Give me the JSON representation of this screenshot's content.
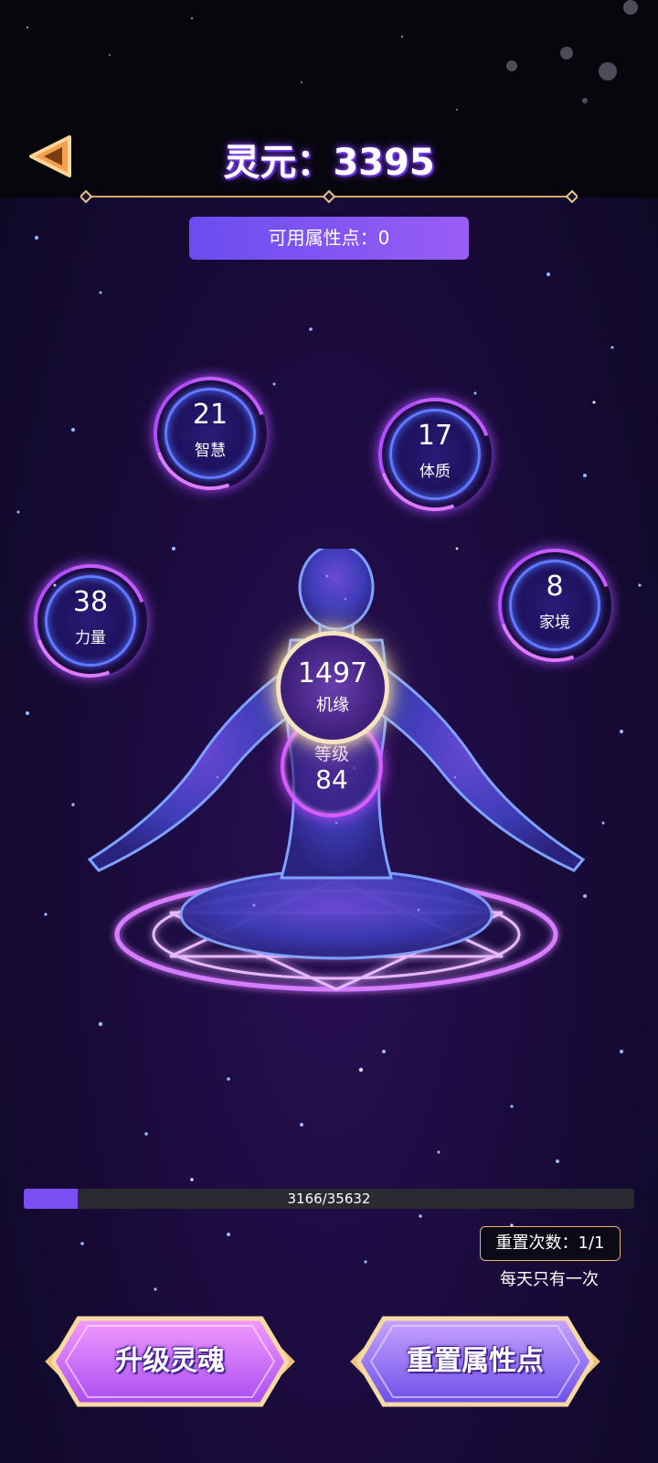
{
  "header": {
    "back_icon": "back-triangle-icon",
    "title": "灵元：3395"
  },
  "points_available": "可用属性点：0",
  "stats": {
    "wisdom": {
      "value": "21",
      "label": "智慧"
    },
    "constitution": {
      "value": "17",
      "label": "体质"
    },
    "strength": {
      "value": "38",
      "label": "力量"
    },
    "family": {
      "value": "8",
      "label": "家境"
    },
    "fortune": {
      "value": "1497",
      "label": "机缘"
    },
    "level": {
      "value": "84",
      "label": "等级"
    }
  },
  "progress": {
    "text": "3166/35632",
    "current": 3166,
    "max": 35632
  },
  "reset": {
    "count_text": "重置次数：1/1",
    "note": "每天只有一次"
  },
  "buttons": {
    "upgrade": "升级灵魂",
    "reset_points": "重置属性点"
  },
  "colors": {
    "accent": "#7a4ef0",
    "gold": "#e6b66d"
  }
}
